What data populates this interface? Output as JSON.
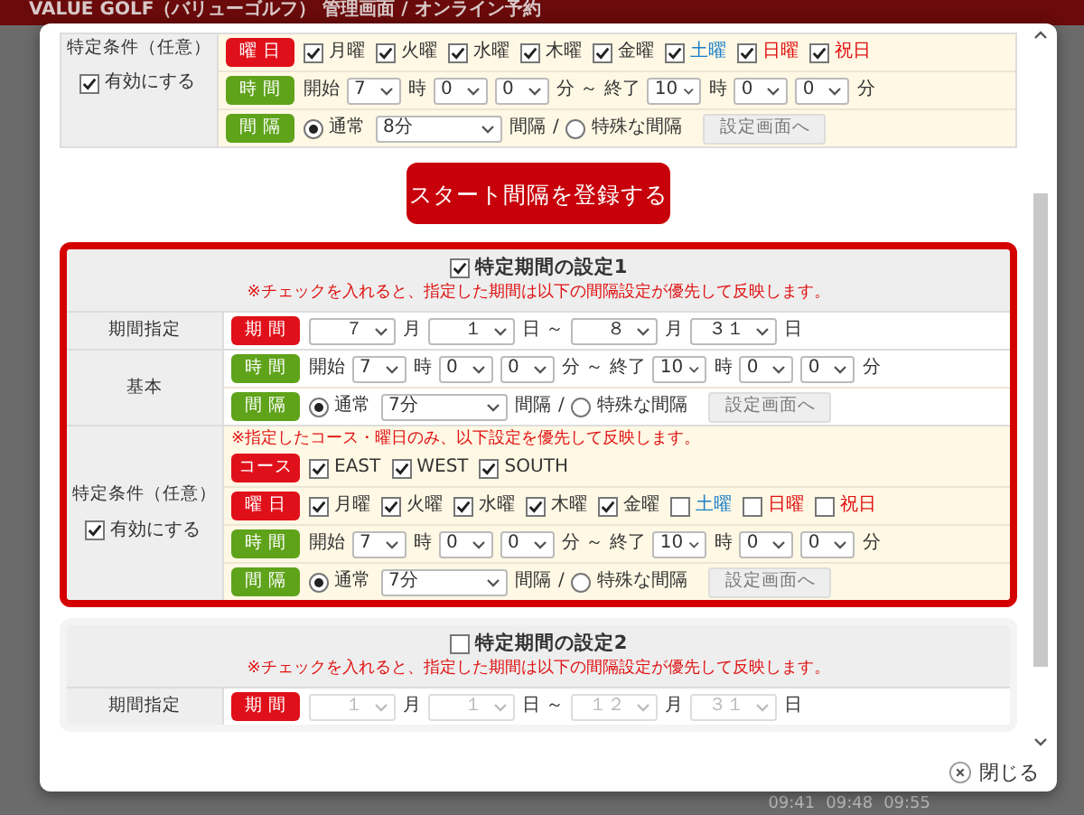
{
  "header": {
    "title": "VALUE GOLF（バリューゴルフ） 管理画面 / オンライン予約"
  },
  "background_times": [
    "09:41",
    "09:48",
    "09:55"
  ],
  "modal": {
    "top_group": {
      "label": "特定条件（任意）",
      "enable": {
        "label": "有効にする",
        "checked": true
      },
      "rows": [
        {
          "badge": "曜 日",
          "color": "#e0101a",
          "parts": [
            {
              "kind": "checkbox",
              "label": "月曜",
              "checked": true,
              "color": "#333333"
            },
            {
              "kind": "checkbox",
              "label": "火曜",
              "checked": true,
              "color": "#333333"
            },
            {
              "kind": "checkbox",
              "label": "水曜",
              "checked": true,
              "color": "#333333"
            },
            {
              "kind": "checkbox",
              "label": "木曜",
              "checked": true,
              "color": "#333333"
            },
            {
              "kind": "checkbox",
              "label": "金曜",
              "checked": true,
              "color": "#333333"
            },
            {
              "kind": "checkbox",
              "label": "土曜",
              "checked": true,
              "color": "#1a7fc8"
            },
            {
              "kind": "checkbox",
              "label": "日曜",
              "checked": true,
              "color": "#e01010"
            },
            {
              "kind": "checkbox",
              "label": "祝日",
              "checked": true,
              "color": "#e01010"
            }
          ]
        },
        {
          "badge": "時 間",
          "color": "#5fa31a",
          "parts": [
            {
              "kind": "text",
              "value": "開始"
            },
            {
              "kind": "select",
              "value": "7"
            },
            {
              "kind": "text",
              "value": "時"
            },
            {
              "kind": "select",
              "value": "0"
            },
            {
              "kind": "select",
              "value": "0"
            },
            {
              "kind": "text",
              "value": "分 ～ 終了"
            },
            {
              "kind": "select",
              "value": "10"
            },
            {
              "kind": "text",
              "value": "時"
            },
            {
              "kind": "select",
              "value": "0"
            },
            {
              "kind": "select",
              "value": "0"
            },
            {
              "kind": "text",
              "value": "分"
            }
          ]
        },
        {
          "badge": "間 隔",
          "color": "#5fa31a",
          "parts": [
            {
              "kind": "radio",
              "label": "通常",
              "selected": true
            },
            {
              "kind": "wide-select",
              "value": "8分"
            },
            {
              "kind": "text",
              "value": "間隔"
            },
            {
              "kind": "text",
              "value": "/"
            },
            {
              "kind": "radio",
              "label": "特殊な間隔",
              "selected": false
            },
            {
              "kind": "button",
              "label": "設定画面へ"
            }
          ]
        }
      ]
    },
    "register_button": "スタート間隔を登録する",
    "periods": [
      {
        "title": "特定期間の設定1",
        "checked": true,
        "note": "※チェックを入れると、指定した期間は以下の間隔設定が優先して反映します。",
        "groups": [
          {
            "label": "期間指定",
            "rows": [
              {
                "badge": "期 間",
                "color": "#e0101a",
                "parts": [
                  {
                    "kind": "period-select",
                    "value": "７",
                    "disabled": false
                  },
                  {
                    "kind": "text",
                    "value": "月"
                  },
                  {
                    "kind": "period-select",
                    "value": "１",
                    "disabled": false
                  },
                  {
                    "kind": "text",
                    "value": "日 ～"
                  },
                  {
                    "kind": "period-select",
                    "value": "８",
                    "disabled": false
                  },
                  {
                    "kind": "text",
                    "value": "月"
                  },
                  {
                    "kind": "period-select",
                    "value": "３１",
                    "disabled": false
                  },
                  {
                    "kind": "text",
                    "value": "日"
                  }
                ]
              }
            ]
          },
          {
            "label": "基本",
            "rows": [
              {
                "badge": "時 間",
                "color": "#5fa31a",
                "parts": [
                  {
                    "kind": "text",
                    "value": "開始"
                  },
                  {
                    "kind": "select",
                    "value": "7"
                  },
                  {
                    "kind": "text",
                    "value": "時"
                  },
                  {
                    "kind": "select",
                    "value": "0"
                  },
                  {
                    "kind": "select",
                    "value": "0"
                  },
                  {
                    "kind": "text",
                    "value": "分 ～ 終了"
                  },
                  {
                    "kind": "select",
                    "value": "10"
                  },
                  {
                    "kind": "text",
                    "value": "時"
                  },
                  {
                    "kind": "select",
                    "value": "0"
                  },
                  {
                    "kind": "select",
                    "value": "0"
                  },
                  {
                    "kind": "text",
                    "value": "分"
                  }
                ]
              },
              {
                "badge": "間 隔",
                "color": "#5fa31a",
                "parts": [
                  {
                    "kind": "radio",
                    "label": "通常",
                    "selected": true
                  },
                  {
                    "kind": "wide-select",
                    "value": "7分"
                  },
                  {
                    "kind": "text",
                    "value": "間隔"
                  },
                  {
                    "kind": "text",
                    "value": "/"
                  },
                  {
                    "kind": "radio",
                    "label": "特殊な間隔",
                    "selected": false
                  },
                  {
                    "kind": "button",
                    "label": "設定画面へ"
                  }
                ]
              }
            ]
          },
          {
            "label": "特定条件（任意）",
            "enable": {
              "label": "有効にする",
              "checked": true
            },
            "note": "※指定したコース・曜日のみ、以下設定を優先して反映します。",
            "rows": [
              {
                "badge": "コース",
                "color": "#e0101a",
                "parts": [
                  {
                    "kind": "checkbox",
                    "label": "EAST",
                    "checked": true,
                    "color": "#333333"
                  },
                  {
                    "kind": "checkbox",
                    "label": "WEST",
                    "checked": true,
                    "color": "#333333"
                  },
                  {
                    "kind": "checkbox",
                    "label": "SOUTH",
                    "checked": true,
                    "color": "#333333"
                  }
                ]
              },
              {
                "badge": "曜 日",
                "color": "#e0101a",
                "parts": [
                  {
                    "kind": "checkbox",
                    "label": "月曜",
                    "checked": true,
                    "color": "#333333"
                  },
                  {
                    "kind": "checkbox",
                    "label": "火曜",
                    "checked": true,
                    "color": "#333333"
                  },
                  {
                    "kind": "checkbox",
                    "label": "水曜",
                    "checked": true,
                    "color": "#333333"
                  },
                  {
                    "kind": "checkbox",
                    "label": "木曜",
                    "checked": true,
                    "color": "#333333"
                  },
                  {
                    "kind": "checkbox",
                    "label": "金曜",
                    "checked": true,
                    "color": "#333333"
                  },
                  {
                    "kind": "checkbox",
                    "label": "土曜",
                    "checked": false,
                    "color": "#1a7fc8"
                  },
                  {
                    "kind": "checkbox",
                    "label": "日曜",
                    "checked": false,
                    "color": "#e01010"
                  },
                  {
                    "kind": "checkbox",
                    "label": "祝日",
                    "checked": false,
                    "color": "#e01010"
                  }
                ]
              },
              {
                "badge": "時 間",
                "color": "#5fa31a",
                "parts": [
                  {
                    "kind": "text",
                    "value": "開始"
                  },
                  {
                    "kind": "select",
                    "value": "7"
                  },
                  {
                    "kind": "text",
                    "value": "時"
                  },
                  {
                    "kind": "select",
                    "value": "0"
                  },
                  {
                    "kind": "select",
                    "value": "0"
                  },
                  {
                    "kind": "text",
                    "value": "分 ～ 終了"
                  },
                  {
                    "kind": "select",
                    "value": "10"
                  },
                  {
                    "kind": "text",
                    "value": "時"
                  },
                  {
                    "kind": "select",
                    "value": "0"
                  },
                  {
                    "kind": "select",
                    "value": "0"
                  },
                  {
                    "kind": "text",
                    "value": "分"
                  }
                ]
              },
              {
                "badge": "間 隔",
                "color": "#5fa31a",
                "parts": [
                  {
                    "kind": "radio",
                    "label": "通常",
                    "selected": true
                  },
                  {
                    "kind": "wide-select",
                    "value": "7分"
                  },
                  {
                    "kind": "text",
                    "value": "間隔"
                  },
                  {
                    "kind": "text",
                    "value": "/"
                  },
                  {
                    "kind": "radio",
                    "label": "特殊な間隔",
                    "selected": false
                  },
                  {
                    "kind": "button",
                    "label": "設定画面へ"
                  }
                ]
              }
            ]
          }
        ]
      },
      {
        "title": "特定期間の設定2",
        "checked": false,
        "note": "※チェックを入れると、指定した期間は以下の間隔設定が優先して反映します。",
        "groups": [
          {
            "label": "期間指定",
            "rows": [
              {
                "badge": "期 間",
                "color": "#e0101a",
                "parts": [
                  {
                    "kind": "period-select",
                    "value": "１",
                    "disabled": true
                  },
                  {
                    "kind": "text",
                    "value": "月"
                  },
                  {
                    "kind": "period-select",
                    "value": "１",
                    "disabled": true
                  },
                  {
                    "kind": "text",
                    "value": "日 ～"
                  },
                  {
                    "kind": "period-select",
                    "value": "１２",
                    "disabled": true
                  },
                  {
                    "kind": "text",
                    "value": "月"
                  },
                  {
                    "kind": "period-select",
                    "value": "３１",
                    "disabled": true
                  },
                  {
                    "kind": "text",
                    "value": "日"
                  }
                ]
              }
            ]
          }
        ]
      }
    ],
    "close": {
      "label": "閉じる"
    }
  }
}
